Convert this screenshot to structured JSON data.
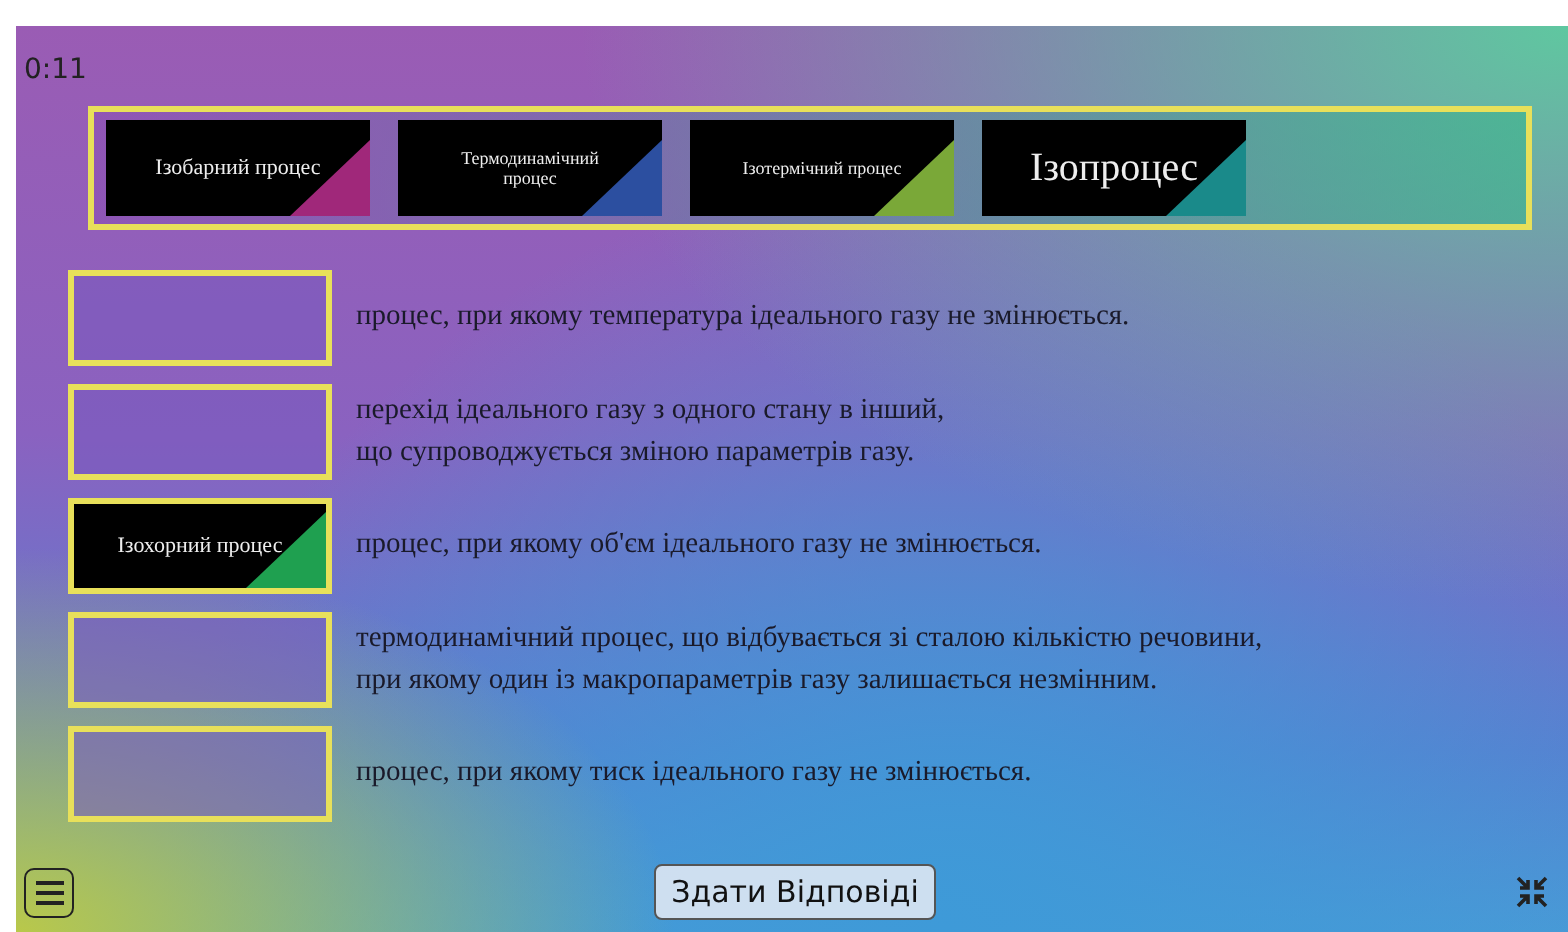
{
  "timer": "0:11",
  "bank": [
    {
      "label": "Ізобарний процес",
      "color": "#a0287a"
    },
    {
      "label": "Термодинамічний процес",
      "color": "#2c4fa0"
    },
    {
      "label": "Ізотермічний процес",
      "color": "#7aa838"
    },
    {
      "label": "Ізопроцес",
      "color": "#1a8a8a",
      "large": true
    }
  ],
  "rows": [
    {
      "answer": null,
      "definition": "процес, при якому температура ідеального газу не змінюється."
    },
    {
      "answer": null,
      "definition": "перехід ідеального газу з одного стану в інший,\nщо супроводжується  зміною параметрів газу."
    },
    {
      "answer": {
        "label": "Ізохорний процес",
        "color": "#1fa050"
      },
      "definition": "процес, при якому об'єм ідеального газу не змінюється."
    },
    {
      "answer": null,
      "definition": "термодинамічний процес, що відбувається зі сталою кількістю речовини,\nпри якому один із макропараметрів газу залишається незмінним."
    },
    {
      "answer": null,
      "definition": "процес, при якому тиск ідеального газу не змінюється."
    }
  ],
  "submit_button": "Здати Відповіді"
}
